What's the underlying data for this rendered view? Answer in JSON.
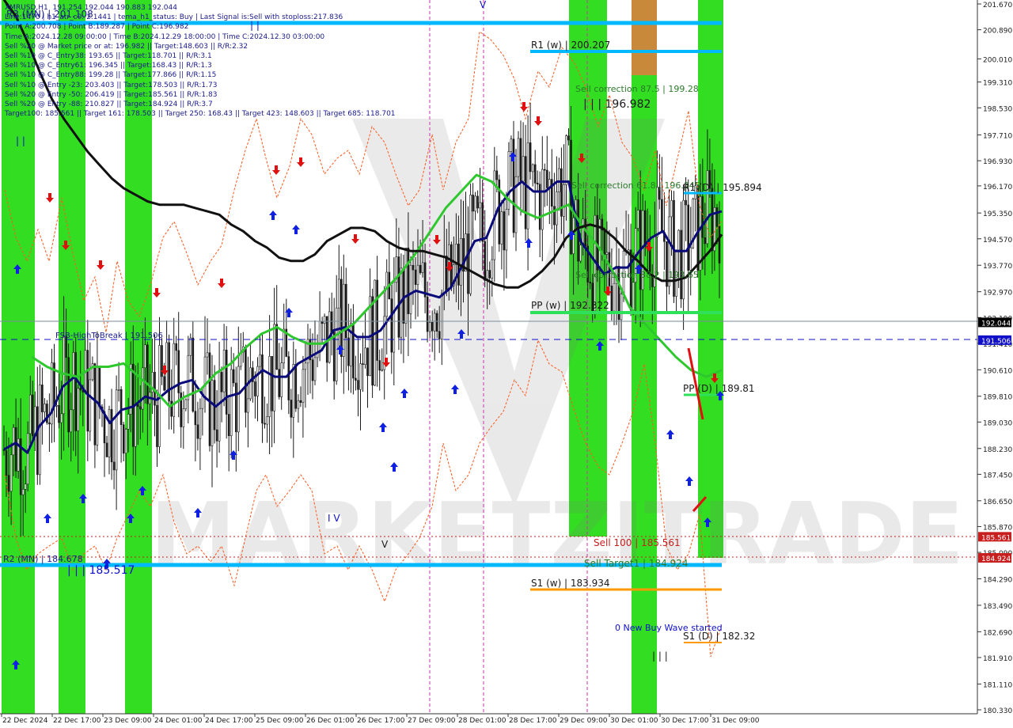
{
  "header": {
    "lines": [
      "XMRUSD,H1  191.254 192.044 190.883 192.044",
      "Line:1470 | h1_atr_c0: 2.1441 | tema_h1_status: Buy | Last Signal is:Sell with stoploss:217.836",
      "Point A:200.708 | Point B:189.287 | Point C:196.982",
      "Time A:2024.12.28 09:00:00 | Time B:2024.12.29 18:00:00 | Time C:2024.12.30 03:00:00",
      "Sell %20 @ Market price or at: 196.982 || Target:148.603 || R/R:2.32",
      "Sell %10 @ C_Entry38: 193.65 || Target:118.701 || R/R:3.1",
      "Sell %10 @ C_Entry61: 196.345 || Target:168.43 || R/R:1.3",
      "Sell %10 @ C_Entry88: 199.28 || Target:177.866 || R/R:1.15",
      "Sell %10 @ Entry -23: 203.403 || Target:178.503 || R/R:1.73",
      "Sell %20 @ Entry -50: 206.419 || Target:185.561 || R/R:1.83",
      "Sell %20 @ Entry -88: 210.827 || Target:184.924 || R/R:3.7",
      "Target100: 185.561 || Target 161: 178.503 || Target 250: 168.43 || Target 423: 148.603 || Target 685: 118.701"
    ]
  },
  "watermark": "MARKETZITRADE",
  "chart_data": {
    "type": "line",
    "symbol": "XMRUSD",
    "timeframe": "H1",
    "ohlc_last": {
      "open": 191.254,
      "high": 192.044,
      "low": 190.883,
      "close": 192.044
    },
    "ylim": [
      180.33,
      201.67
    ],
    "y_ticks": [
      "201.670",
      "200.890",
      "200.010",
      "199.310",
      "198.530",
      "197.710",
      "196.930",
      "196.170",
      "195.350",
      "194.570",
      "193.770",
      "192.970",
      "192.190",
      "191.410",
      "190.610",
      "189.810",
      "189.030",
      "188.230",
      "187.450",
      "186.650",
      "185.870",
      "185.090",
      "184.290",
      "183.490",
      "182.690",
      "181.910",
      "181.110",
      "180.330"
    ],
    "x_ticks": [
      "22 Dec 2024",
      "22 Dec 17:00",
      "23 Dec 09:00",
      "24 Dec 01:00",
      "24 Dec 17:00",
      "25 Dec 09:00",
      "26 Dec 01:00",
      "26 Dec 17:00",
      "27 Dec 09:00",
      "28 Dec 01:00",
      "28 Dec 17:00",
      "29 Dec 09:00",
      "30 Dec 01:00",
      "30 Dec 17:00",
      "31 Dec 09:00"
    ],
    "price_tags": [
      {
        "label": "192.044",
        "value": 192.044,
        "color": "#000000"
      },
      {
        "label": "191.506",
        "value": 191.506,
        "color": "#1010c8"
      },
      {
        "label": "185.561",
        "value": 185.561,
        "color": "#c81e1e"
      },
      {
        "label": "184.924",
        "value": 184.924,
        "color": "#c81e1e"
      }
    ],
    "levels": [
      {
        "label": "R3 (MN) | 201.108",
        "value": 201.108,
        "color": "#00b8ff"
      },
      {
        "label": "R1 (w) | 200.207",
        "value": 200.207,
        "color": "#00b8ff"
      },
      {
        "label": "Sell correction 87.5 | 199.28",
        "value": 199.28,
        "color": "#2a7a2a"
      },
      {
        "label": "| | | 196.982",
        "value": 196.982,
        "color": "#1a1a1a"
      },
      {
        "label": "Sell correction 61.8 | 196.345",
        "value": 196.345,
        "color": "#2a7a2a"
      },
      {
        "label": "R1 (D) | 195.894",
        "value": 195.894,
        "color": "#00b8ff"
      },
      {
        "label": "Sell correction 38.2 | 193.65",
        "value": 193.65,
        "color": "#2a7a2a"
      },
      {
        "label": "PP (w) | 192.322",
        "value": 192.322,
        "color": "#2ee05a"
      },
      {
        "label": "FSB-HighToBreak | 191.506",
        "value": 191.506,
        "color": "#1a1a8a"
      },
      {
        "label": "PP (D) | 189.81",
        "value": 189.81,
        "color": "#2ee05a"
      },
      {
        "label": "Sell 100 | 185.561",
        "value": 185.561,
        "color": "#c81e1e"
      },
      {
        "label": "Sell Target1 | 184.924",
        "value": 184.924,
        "color": "#2a7a2a"
      },
      {
        "label": "R2 (MN) | 184.678",
        "value": 184.678,
        "color": "#1a1a8a"
      },
      {
        "label": "| | | 185.517",
        "value": 185.517,
        "color": "#1010c8"
      },
      {
        "label": "S1 (w) | 183.934",
        "value": 183.934,
        "color": "#ff9900"
      },
      {
        "label": "S1 (D) | 182.32",
        "value": 182.32,
        "color": "#ff9900"
      },
      {
        "label": "0 New Buy Wave started",
        "value": 182.6,
        "color": "#1010c8"
      }
    ],
    "markers": [
      "| |",
      "| |",
      "I V",
      "V",
      "| | |",
      "V"
    ],
    "series": [
      {
        "values": [
          188.2,
          188.4,
          188.1,
          188.9,
          189.3,
          190.1,
          190.4,
          189.9,
          189.6,
          189.0,
          189.4,
          189.5,
          189.8,
          189.7,
          190.0,
          190.2,
          190.3,
          189.8,
          189.5,
          189.8,
          189.9,
          190.3,
          190.6,
          190.4,
          190.4,
          190.8,
          191.0,
          191.2,
          191.8,
          191.9,
          191.6,
          191.6,
          191.8,
          192.3,
          192.8,
          193.0,
          192.9,
          192.8,
          193.1,
          193.8,
          194.5,
          194.6,
          195.5,
          196.0,
          196.3,
          196.0,
          196.0,
          196.3,
          196.3,
          194.5,
          194.0,
          193.5,
          193.7,
          193.7,
          194.2,
          194.6,
          194.8,
          194.2,
          194.2,
          194.8,
          195.3,
          195.4
        ],
        "color": "#0a0a78"
      },
      {
        "values": [
          191.0,
          190.7,
          190.5,
          190.4,
          190.7,
          190.7,
          190.8,
          190.4,
          190.0,
          189.5,
          189.8,
          190.0,
          190.5,
          190.8,
          191.3,
          191.7,
          191.9,
          191.6,
          191.4,
          191.4,
          191.7,
          192.0,
          192.5,
          193.0,
          193.5,
          194.1,
          194.8,
          195.5,
          196.0,
          196.5,
          196.3,
          195.8,
          195.4,
          195.2,
          195.4,
          195.6,
          194.9,
          194.3,
          193.5,
          192.5,
          192.0,
          191.5,
          191.0,
          190.6,
          190.4,
          190.6
        ],
        "color": "#2ec82e"
      },
      {
        "values": [
          201.8,
          201.3,
          200.5,
          199.6,
          198.8,
          198.2,
          197.7,
          197.2,
          196.8,
          196.4,
          196.1,
          195.9,
          195.7,
          195.6,
          195.6,
          195.6,
          195.5,
          195.4,
          195.3,
          195.0,
          194.8,
          194.5,
          194.3,
          194.0,
          193.9,
          193.9,
          194.1,
          194.5,
          194.7,
          194.9,
          194.9,
          194.8,
          194.5,
          194.3,
          194.2,
          194.2,
          194.1,
          194.0,
          193.8,
          193.6,
          193.4,
          193.2,
          193.1,
          193.1,
          193.3,
          193.6,
          194.0,
          194.6,
          194.9,
          195.0,
          194.9,
          194.6,
          194.2,
          193.9,
          193.5,
          193.3,
          193.3,
          193.4,
          193.8,
          194.2,
          194.7
        ],
        "color": "#111111"
      }
    ]
  }
}
